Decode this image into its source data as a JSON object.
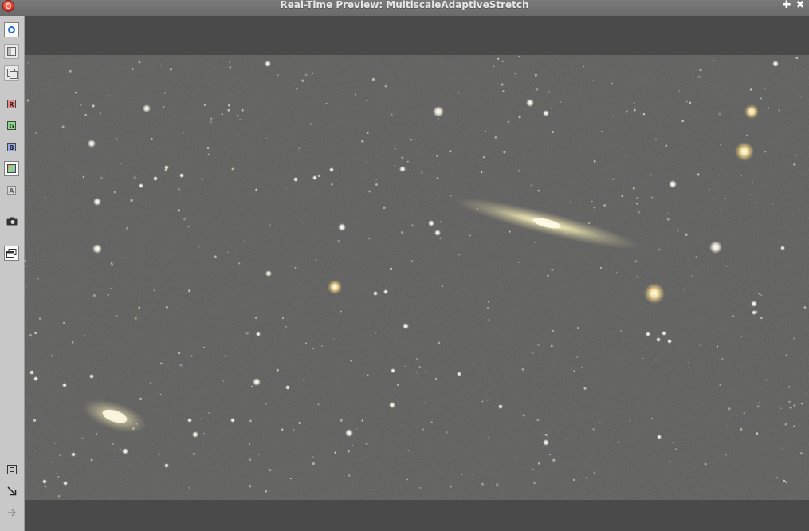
{
  "window": {
    "title": "Real-Time Preview: MultiscaleAdaptiveStretch",
    "controls": {
      "close_icon": "close-icon",
      "add_icon": "plus-icon",
      "x_icon": "x-icon",
      "add_glyph": "✚",
      "x_glyph": "✖"
    }
  },
  "toolbar": {
    "items": [
      {
        "name": "preview-mode-button",
        "icon": "circle-icon"
      },
      {
        "name": "split-view-button",
        "icon": "split-view-icon"
      },
      {
        "name": "overlay-button",
        "icon": "overlay-icon"
      },
      {
        "name": "red-channel-button",
        "label": "R",
        "color": "#e88b8b"
      },
      {
        "name": "green-channel-button",
        "label": "G",
        "color": "#8bdc8b"
      },
      {
        "name": "blue-channel-button",
        "label": "B",
        "color": "#9aa7e8"
      },
      {
        "name": "rgb-channel-button",
        "icon": "rgb-icon"
      },
      {
        "name": "alpha-channel-button",
        "label": "A",
        "color": "#d8d8d8"
      },
      {
        "name": "snapshot-button",
        "icon": "camera-icon"
      },
      {
        "name": "new-window-button",
        "icon": "window-icon"
      },
      {
        "name": "fit-button",
        "icon": "fit-icon"
      },
      {
        "name": "zoom-to-fit-button",
        "icon": "arrow-diagonal-icon"
      },
      {
        "name": "track-button",
        "icon": "arrow-right-icon"
      }
    ]
  },
  "image": {
    "description_icon": "astro-image",
    "background": "#5d5d5c",
    "galaxy_color": "#e8e0b0"
  }
}
